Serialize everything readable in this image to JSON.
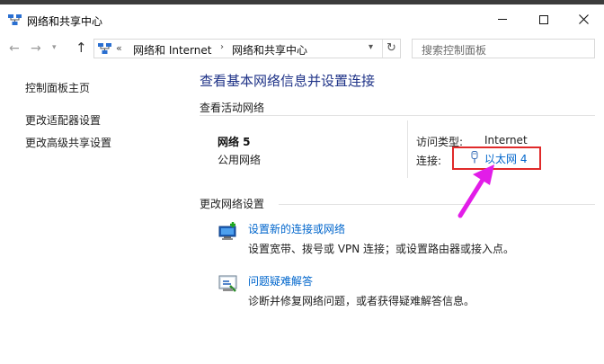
{
  "window": {
    "title": "网络和共享中心",
    "minimize_icon": "minimize-icon",
    "maximize_icon": "maximize-icon",
    "close_icon": "close-icon"
  },
  "nav": {
    "back_icon": "arrow-left-icon",
    "forward_icon": "arrow-right-icon",
    "recent_icon": "chevron-down-icon",
    "up_icon": "arrow-up-icon"
  },
  "address": {
    "separator": "«",
    "crumbs": [
      "网络和 Internet",
      "网络和共享中心"
    ],
    "crumb_separator": "›",
    "refresh_icon": "refresh-icon"
  },
  "search": {
    "placeholder": "搜索控制面板"
  },
  "left_pane": {
    "home_link": "控制面板主页",
    "links": [
      "更改适配器设置",
      "更改高级共享设置"
    ]
  },
  "main": {
    "title": "查看基本网络信息并设置连接",
    "active_networks_heading": "查看活动网络",
    "network": {
      "name": "网络  5",
      "category": "公用网络",
      "access_type_label": "访问类型:",
      "access_type_value": "Internet",
      "connections_label": "连接:",
      "connection_link": "以太网 4",
      "connection_icon": "ethernet-plug-icon"
    },
    "change_settings_heading": "更改网络设置",
    "tasks": [
      {
        "icon": "new-connection-icon",
        "link": "设置新的连接或网络",
        "description": "设置宽带、拨号或 VPN 连接；或设置路由器或接入点。"
      },
      {
        "icon": "troubleshoot-icon",
        "link": "问题疑难解答",
        "description": "诊断并修复网络问题，或者获得疑难解答信息。"
      }
    ]
  },
  "annotation": {
    "box_color": "#e02a2a",
    "arrow_color": "#e21de8"
  },
  "colors": {
    "link": "#0066cc",
    "title": "#1e3287"
  }
}
